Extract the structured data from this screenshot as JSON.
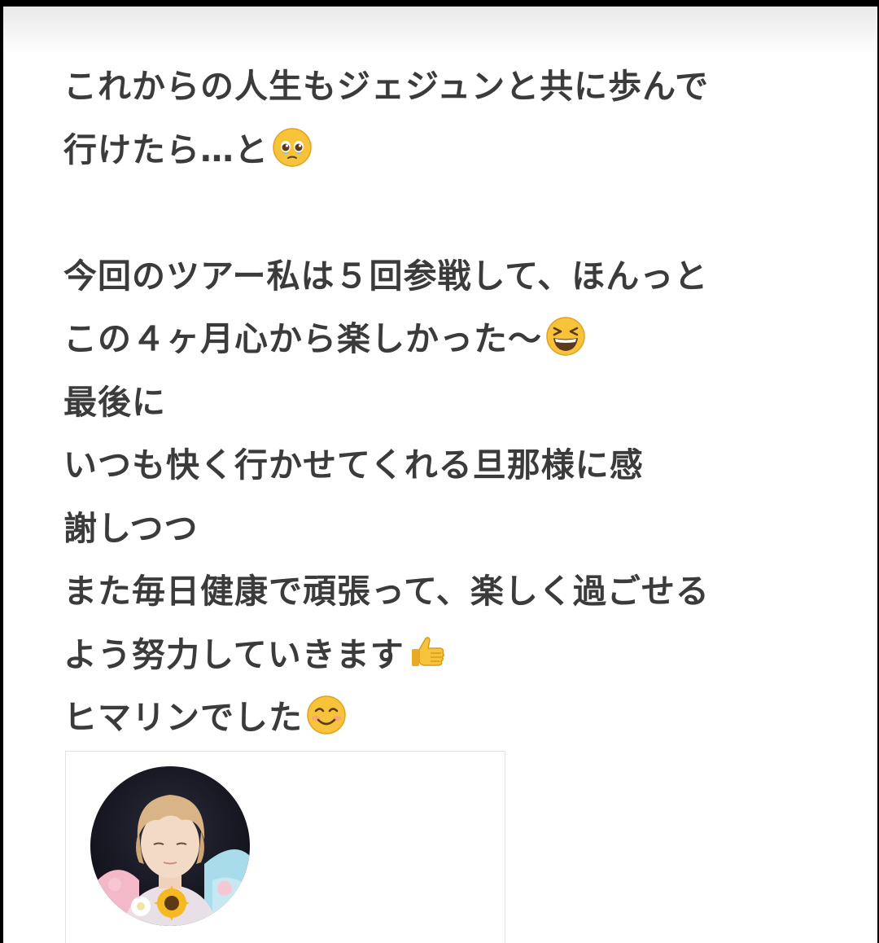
{
  "post": {
    "lines": [
      "これからの人生もジェジュンと共に歩んで",
      "行けたら…と",
      "",
      "今回のツアー私は５回参戦して、ほんっと",
      "この４ヶ月心から楽しかった〜",
      "最後に",
      "いつも快く行かせてくれる旦那様に感",
      "謝しつつ",
      "また毎日健康で頑張って、楽しく過ごせる",
      "よう努力していきます",
      "ヒマリンでした"
    ],
    "emojis": {
      "line_1": "pleading-tearful-face-emoji",
      "line_4": "grinning-squinting-face-emoji",
      "line_9": "thumbs-up-emoji",
      "line_10": "smiling-face-emoji"
    }
  },
  "profile": {
    "avatar_icon": "profile-avatar-photo"
  },
  "colors": {
    "text": "#3b3b3b",
    "background": "#ffffff",
    "frame": "#000000",
    "card_border": "#e2e2e2",
    "emoji_yellow": "#f7c33a"
  }
}
